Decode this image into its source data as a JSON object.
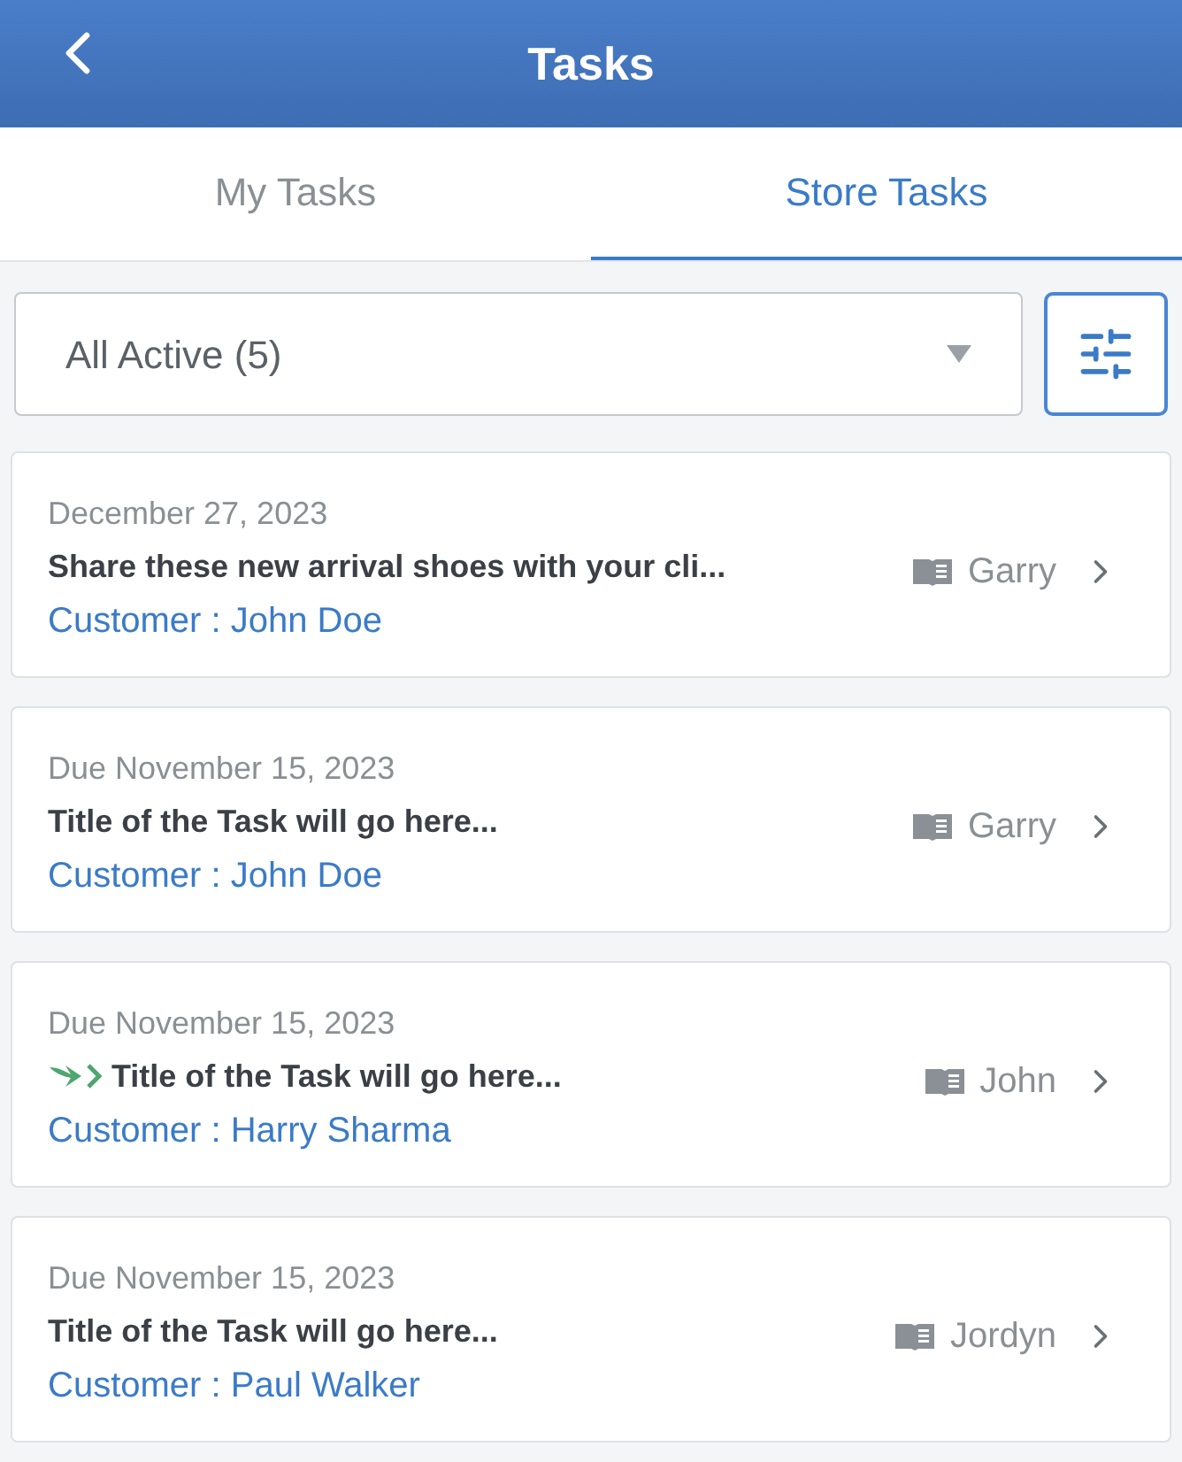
{
  "header": {
    "title": "Tasks"
  },
  "tabs": [
    {
      "label": "My Tasks",
      "selected": false
    },
    {
      "label": "Store Tasks",
      "selected": true
    }
  ],
  "filter": {
    "value": "All Active (5)"
  },
  "tasks": [
    {
      "date": "December 27, 2023",
      "title": "Share these new arrival shoes with your cli...",
      "forwarded": false,
      "assignee": "Garry",
      "customer": "Customer : John Doe"
    },
    {
      "date": "Due November 15, 2023",
      "title": "Title of the Task will go here...",
      "forwarded": false,
      "assignee": "Garry",
      "customer": "Customer : John Doe"
    },
    {
      "date": "Due November 15, 2023",
      "title": "Title of the Task will go here...",
      "forwarded": true,
      "assignee": "John",
      "customer": "Customer : Harry Sharma"
    },
    {
      "date": "Due November 15, 2023",
      "title": "Title of the Task will go here...",
      "forwarded": false,
      "assignee": "Jordyn",
      "customer": "Customer : Paul Walker"
    }
  ]
}
